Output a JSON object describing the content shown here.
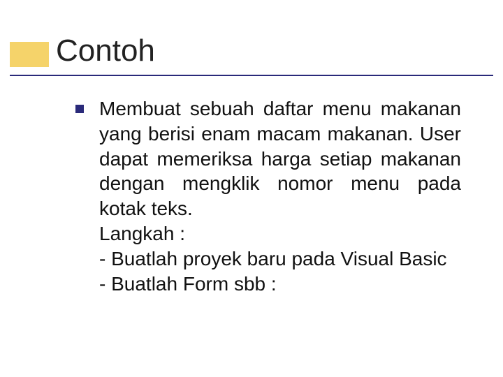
{
  "title": "Contoh",
  "body": {
    "paragraph": "Membuat sebuah daftar menu makanan yang berisi enam macam makanan. User dapat memeriksa harga setiap makanan dengan mengklik nomor menu pada kotak teks.",
    "langkah_label": "Langkah :",
    "steps": [
      "- Buatlah proyek baru pada Visual Basic",
      "- Buatlah Form sbb :"
    ]
  },
  "colors": {
    "accent_yellow": "#f5d36a",
    "rule_blue": "#2a2a7a",
    "bullet_blue": "#2a2a7a"
  }
}
